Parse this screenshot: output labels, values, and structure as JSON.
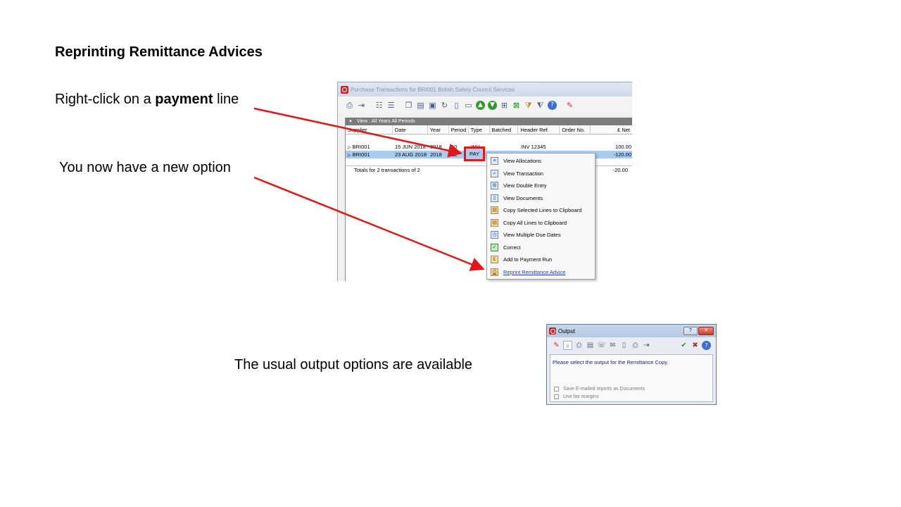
{
  "slide": {
    "title": "Reprinting Remittance Advices",
    "caption1": {
      "prefix": "Right-click on a ",
      "bold": "payment",
      "suffix": " line"
    },
    "caption2": "You now have a new option",
    "caption3": "The usual output options are available"
  },
  "transactions_window": {
    "title": "Purchase Transactions for BRI001 British Safety Council Services",
    "toolbar_icons": [
      "print-icon",
      "export-icon",
      "columns-icon",
      "list-icon",
      "copy-icon",
      "paste-icon",
      "save-icon",
      "refresh-icon",
      "page-icon",
      "page-add-icon",
      "arrow-up-green-icon",
      "arrow-down-green-icon",
      "view-icon",
      "excel-icon",
      "filter-icon",
      "filter-clear-icon",
      "help-icon",
      "pin-icon"
    ],
    "view_label": "View : All Years All Periods",
    "columns": [
      "Supplier",
      "Date",
      "Year",
      "Period",
      "Type",
      "Batched",
      "Header Ref.",
      "Order No.",
      "£ Net"
    ],
    "rows": [
      {
        "supplier": "BRI001",
        "date": "15 JUN 2018",
        "year": "2018",
        "period": "10",
        "type": "INV",
        "batched": "",
        "header_ref": "INV 12345",
        "order_no": "",
        "net": "100.00"
      },
      {
        "supplier": "BRI001",
        "date": "23 AUG 2018",
        "year": "2018",
        "period": "12",
        "type": "PAY",
        "batched": "",
        "header_ref": "",
        "order_no": "",
        "net": "-120.00"
      }
    ],
    "totals_label": "Totals for 2 transactions of 2",
    "totals_value": "-20.00"
  },
  "context_menu": {
    "items": [
      {
        "label": "View Allocations",
        "icon": "allocations-icon"
      },
      {
        "label": "View Transaction",
        "icon": "transaction-icon"
      },
      {
        "label": "View Double Entry",
        "icon": "double-entry-icon"
      },
      {
        "label": "View Documents",
        "icon": "documents-icon"
      },
      {
        "label": "Copy Selected Lines to Clipboard",
        "icon": "clipboard-icon"
      },
      {
        "label": "Copy All Lines to Clipboard",
        "icon": "clipboard-all-icon"
      },
      {
        "label": "View Multiple Due Dates",
        "icon": "due-dates-icon"
      },
      {
        "label": "Correct",
        "icon": "correct-icon"
      },
      {
        "label": "Add to Payment Run",
        "icon": "payment-run-icon"
      },
      {
        "label": "Reprint Remittance Advice",
        "icon": "printer-icon"
      }
    ]
  },
  "output_dialog": {
    "title": "Output",
    "help_btn": "?",
    "close_btn": "✕",
    "message": "Please select the output for the Remittance Copy.",
    "options": [
      {
        "label": "Save E-mailed reports as Documents",
        "checked": false
      },
      {
        "label": "Use fax margins",
        "checked": false
      }
    ]
  },
  "colors": {
    "arrow": "#e01818",
    "selection": "#a9cbf0",
    "link": "#2a3bb8"
  }
}
